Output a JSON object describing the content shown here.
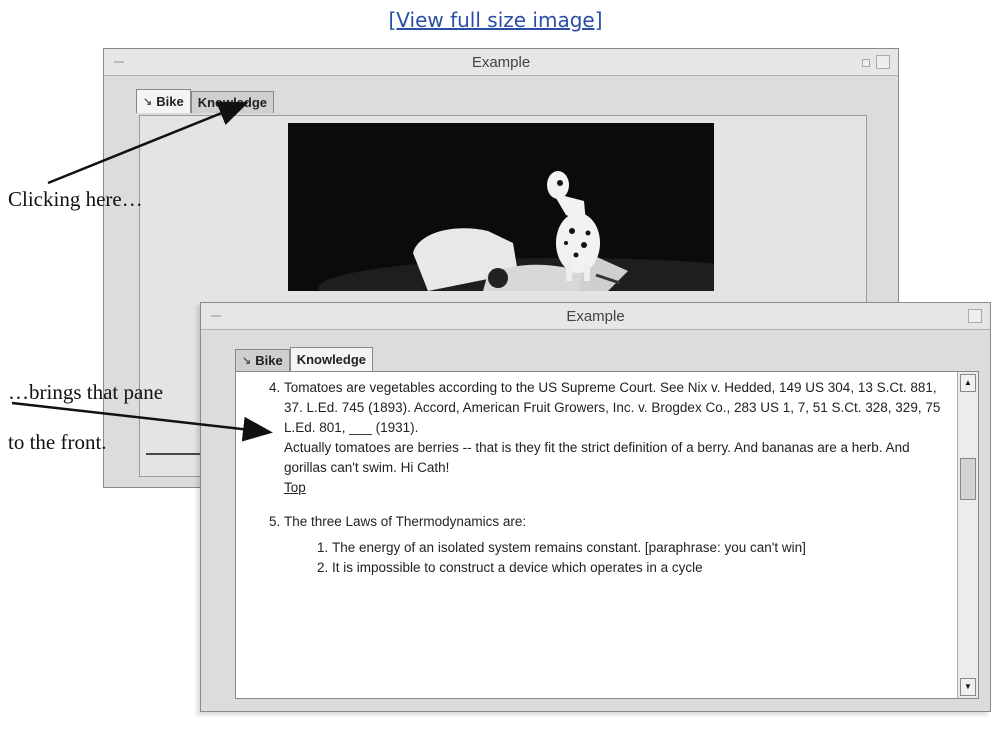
{
  "top_link": "[View full size image]",
  "back_window": {
    "title": "Example",
    "tabs": [
      {
        "label": "Bike",
        "selected": true,
        "icon": "bike-icon"
      },
      {
        "label": "Knowledge",
        "selected": false
      }
    ]
  },
  "front_window": {
    "title": "Example",
    "tabs": [
      {
        "label": "Bike",
        "selected": false,
        "icon": "bike-icon"
      },
      {
        "label": "Knowledge",
        "selected": true
      }
    ],
    "items": [
      {
        "number": "4.",
        "text": "Tomatoes are vegetables according to the US Supreme Court. See Nix v. Hedded, 149 US 304, 13 S.Ct. 881, 37. L.Ed. 745 (1893). Accord, American Fruit Growers, Inc. v. Brogdex Co., 283 US 1, 7, 51 S.Ct. 328, 329, 75 L.Ed. 801, ___ (1931).",
        "extra": "Actually tomatoes are berries -- that is they fit the strict definition of a berry. And bananas are a herb. And gorillas can't swim. Hi Cath!",
        "link": "Top"
      },
      {
        "number": "5.",
        "text": "The three Laws of Thermodynamics are:",
        "subitems": [
          "The energy of an isolated system remains constant. [paraphrase: you can't win]",
          "It is impossible to construct a device which operates in a cycle"
        ]
      }
    ]
  },
  "annotations": {
    "clicking": "Clicking here…",
    "brings": "…brings that pane",
    "front": "to the front."
  }
}
